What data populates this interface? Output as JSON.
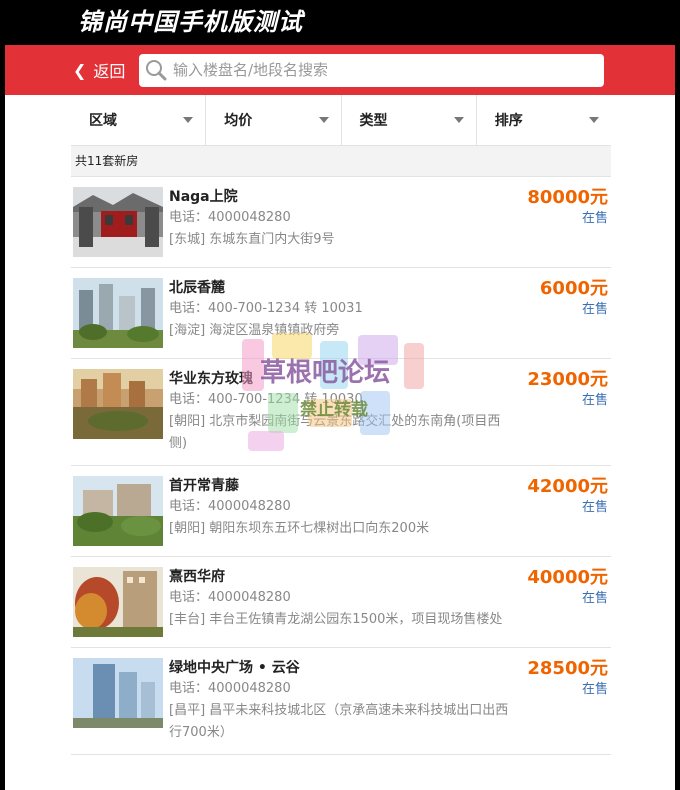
{
  "top_title": "锦尚中国手机版测试",
  "header": {
    "back_label": "返回",
    "search_placeholder": "输入楼盘名/地段名搜索"
  },
  "filters": [
    "区域",
    "均价",
    "类型",
    "排序"
  ],
  "count_text": "共11套新房",
  "listings": [
    {
      "name": "Naga上院",
      "phone": "电话：4000048280",
      "address": "[东城] 东城东直门内大街9号",
      "price": "80000",
      "unit": "元",
      "status": "在售"
    },
    {
      "name": "北辰香麓",
      "phone": "电话：400-700-1234 转 10031",
      "address": "[海淀] 海淀区温泉镇镇政府旁",
      "price": "6000",
      "unit": "元",
      "status": "在售"
    },
    {
      "name": "华业东方玫瑰",
      "phone": "电话：400-700-1234 转 10030",
      "address": "[朝阳] 北京市梨园南街与云景东路交汇处的东南角(项目西侧)",
      "price": "23000",
      "unit": "元",
      "status": "在售"
    },
    {
      "name": "首开常青藤",
      "phone": "电话：4000048280",
      "address": "[朝阳] 朝阳东坝东五环七棵树出口向东200米",
      "price": "42000",
      "unit": "元",
      "status": "在售"
    },
    {
      "name": "熹西华府",
      "phone": "电话：4000048280",
      "address": "[丰台] 丰台王佐镇青龙湖公园东1500米，项目现场售楼处",
      "price": "40000",
      "unit": "元",
      "status": "在售"
    },
    {
      "name": "绿地中央广场 • 云谷",
      "phone": "电话：4000048280",
      "address": "[昌平] 昌平未来科技城北区（京承高速未来科技城出口出西行700米）",
      "price": "28500",
      "unit": "元",
      "status": "在售"
    }
  ],
  "watermark": {
    "line1": "草根吧论坛",
    "line2": "禁止转载"
  },
  "colors": {
    "brand_red": "#e23238",
    "price_orange": "#f06400",
    "status_blue": "#3a6fb3"
  }
}
